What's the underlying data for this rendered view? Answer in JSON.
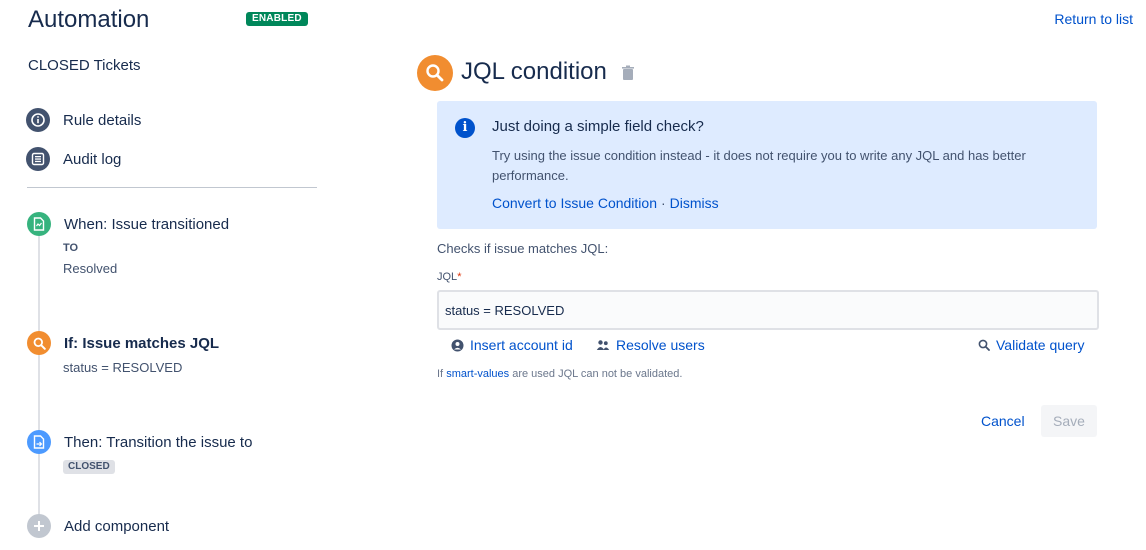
{
  "header": {
    "title": "Automation",
    "status_badge": "ENABLED",
    "return_link": "Return to list",
    "rule_name": "CLOSED Tickets"
  },
  "nav": {
    "items": [
      {
        "label": "Rule details",
        "icon": "info-icon"
      },
      {
        "label": "Audit log",
        "icon": "list-icon"
      }
    ]
  },
  "steps": {
    "trigger": {
      "title": "When: Issue transitioned",
      "sub_label": "TO",
      "value": "Resolved",
      "icon": "trigger-icon",
      "color": "#36b37e"
    },
    "condition": {
      "title": "If: Issue matches JQL",
      "value": "status = RESOLVED",
      "icon": "search-icon",
      "color": "#f18d30"
    },
    "action": {
      "title": "Then: Transition the issue to",
      "badge": "CLOSED",
      "icon": "action-icon",
      "color": "#4c9aff"
    },
    "add": {
      "title": "Add component",
      "icon": "plus-icon",
      "color": "#c1c7d0"
    }
  },
  "panel": {
    "title": "JQL condition",
    "info": {
      "title": "Just doing a simple field check?",
      "body": "Try using the issue condition instead - it does not require you to write any JQL and has better performance.",
      "convert_link": "Convert to Issue Condition",
      "separator": "·",
      "dismiss_link": "Dismiss"
    },
    "description": "Checks if issue matches JQL:",
    "field_label": "JQL",
    "required_marker": "*",
    "jql_value": "status = RESOLVED",
    "insert_account_id": "Insert account id",
    "resolve_users": "Resolve users",
    "validate_query": "Validate query",
    "hint_prefix": "If",
    "hint_link": "smart-values",
    "hint_suffix": "are used JQL can not be validated.",
    "cancel": "Cancel",
    "save": "Save"
  },
  "colors": {
    "accent": "#0052cc",
    "enabled": "#00875a",
    "info_bg": "#deebff"
  }
}
